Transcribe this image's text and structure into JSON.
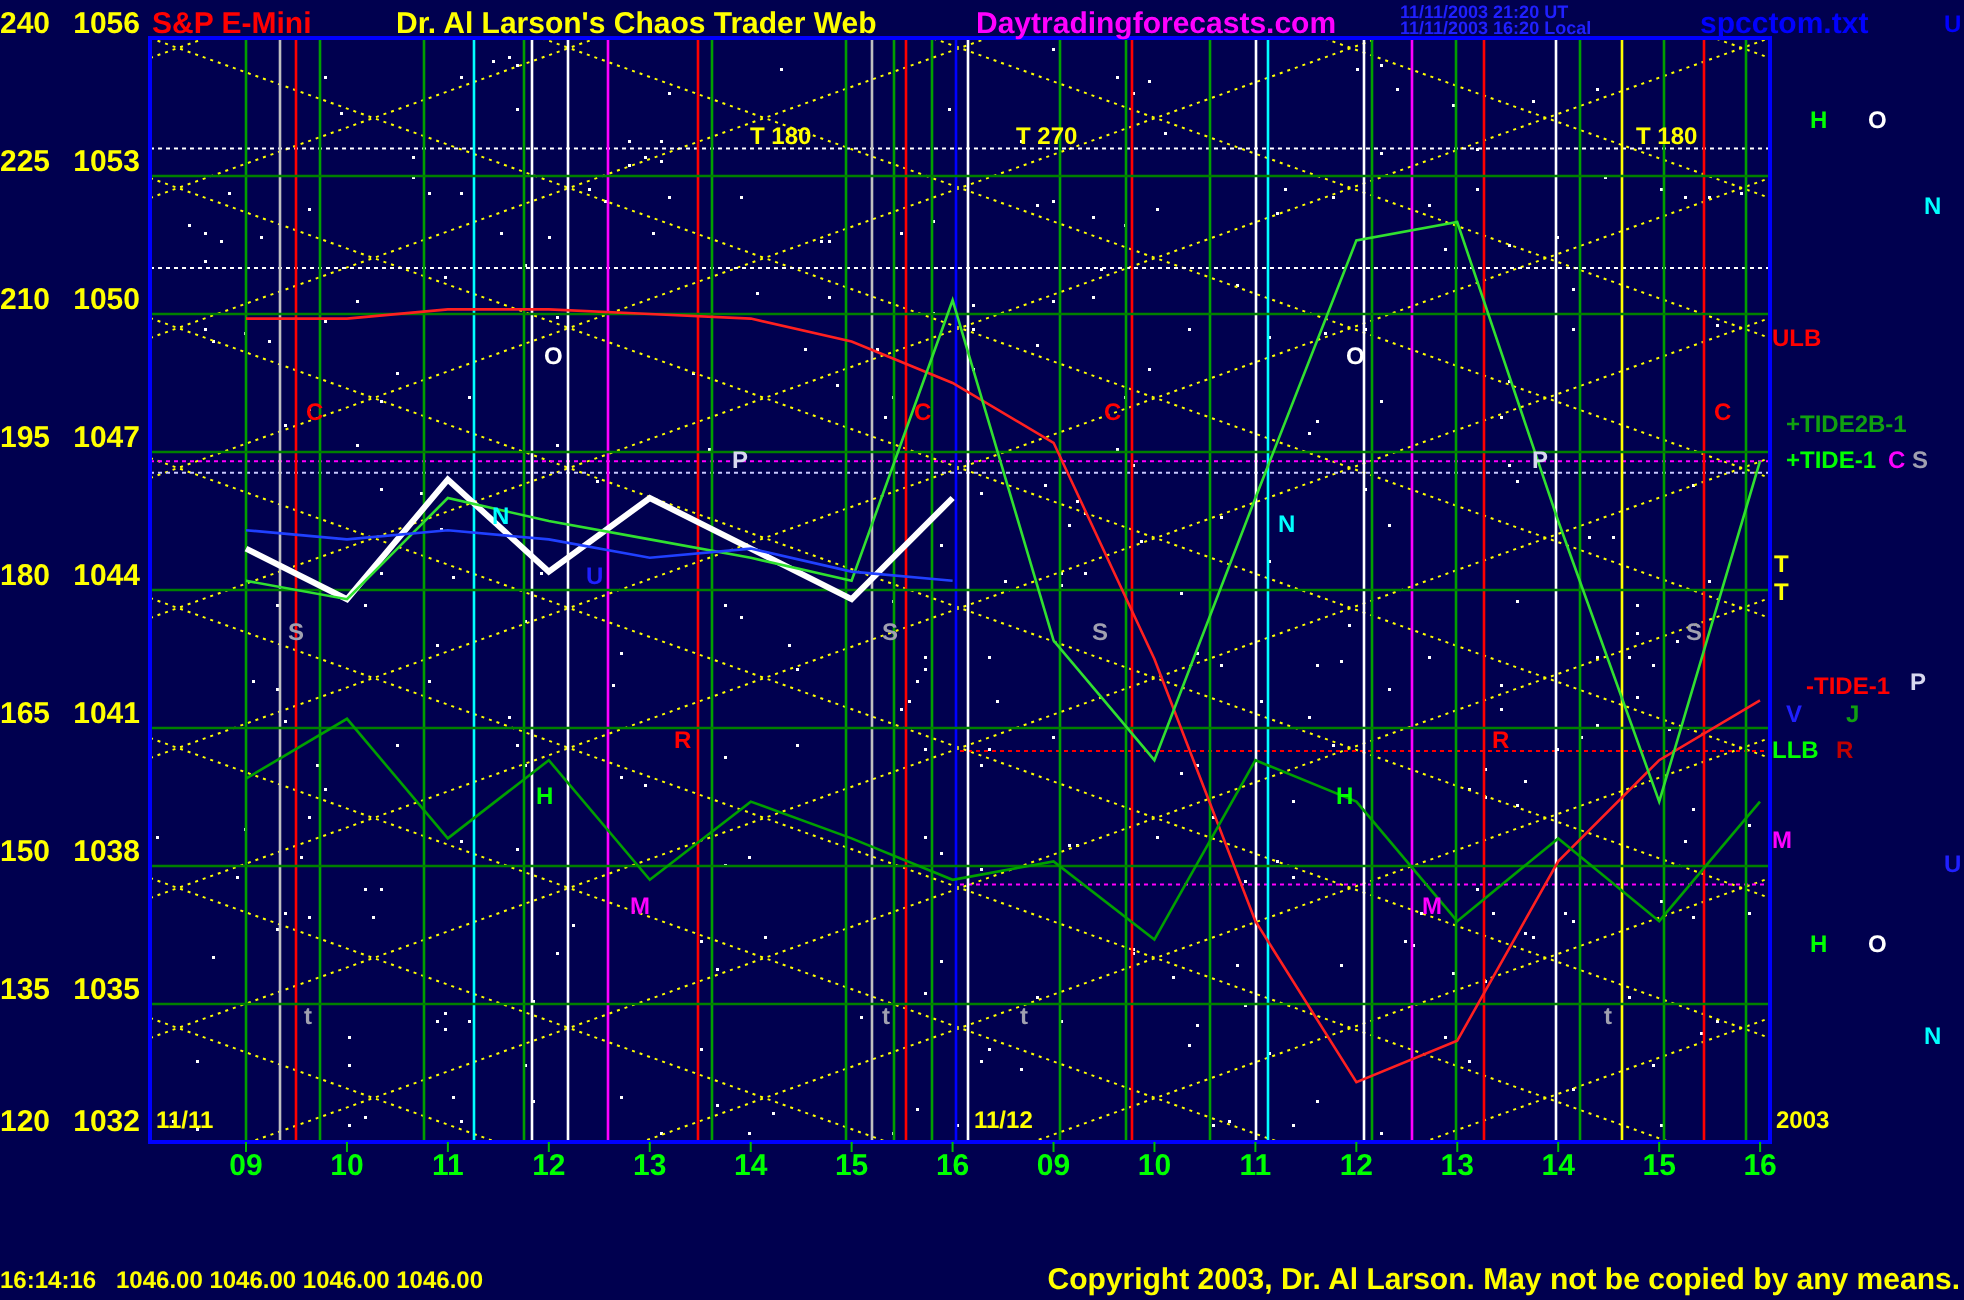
{
  "header": [
    {
      "kind": "site",
      "text": "Dr. Al Larson's Chaos Trader Web"
    },
    {
      "kind": "link",
      "text": "Daytradingforecasts.com"
    },
    {
      "kind": "timestamp",
      "text": "11/11/2003 21:20 UT"
    },
    {
      "kind": "timestamp",
      "text": "11/11/2003 16:20 Local"
    },
    {
      "kind": "file",
      "text": "spcctom.txt"
    },
    {
      "kind": "marker",
      "text": "U"
    }
  ],
  "chart": {
    "scale_labels": [
      "240",
      "225",
      "210",
      "195",
      "180",
      "165",
      "150",
      "135",
      "120"
    ],
    "chart_data": {
      "type": "line",
      "title": "S&P E-Mini",
      "categories": [
        "09",
        "10",
        "11",
        "12",
        "13",
        "14",
        "15",
        "16",
        "09",
        "10",
        "11",
        "12",
        "13",
        "14",
        "15",
        "16"
      ],
      "series": [
        {
          "color": "#ffffff",
          "values": [
            1044.9,
            1043.8,
            1046.4,
            1044.4,
            1046.0,
            1044.9,
            1043.8,
            1046.0,
            null,
            null,
            null,
            null,
            null,
            null,
            null,
            null
          ]
        },
        {
          "color": "#ff2020",
          "values": [
            1049.9,
            1049.9,
            1050.1,
            1050.1,
            1050.0,
            1049.9,
            1049.4,
            1048.5,
            1047.2,
            1042.5,
            1036.8,
            1033.3,
            1034.2,
            1038.1,
            1040.3,
            1041.6
          ]
        },
        {
          "color": "#30e030",
          "values": [
            1044.2,
            1043.8,
            1046.0,
            1045.5,
            1045.1,
            1044.7,
            1044.2,
            1050.3,
            1042.9,
            1040.3,
            1046.0,
            1051.6,
            1052.0,
            1045.5,
            1039.4,
            1046.8
          ]
        },
        {
          "color": "#2040ff",
          "values": [
            1045.3,
            1045.1,
            1045.3,
            1045.1,
            1044.7,
            1044.9,
            1044.4,
            1044.2,
            null,
            null,
            null,
            null,
            null,
            null,
            null,
            null
          ]
        },
        {
          "color": "#00a000",
          "values": [
            1039.9,
            1041.2,
            1038.6,
            1040.3,
            1037.7,
            1039.4,
            1038.6,
            1037.7,
            1038.1,
            1036.4,
            1040.3,
            1039.4,
            1036.8,
            1038.6,
            1036.8,
            1039.4
          ]
        }
      ],
      "ylim": [
        1032,
        1056
      ],
      "yticks": [
        1056,
        1053,
        1050,
        1047,
        1044,
        1041,
        1038,
        1035,
        1032
      ],
      "grid": true
    },
    "markers": [
      {
        "text": "H",
        "color": "#00ff00"
      },
      {
        "text": "O",
        "color": "#ffffff"
      },
      {
        "text": "T 180",
        "color": "#ffff00"
      },
      {
        "text": "T 270",
        "color": "#ffff00"
      },
      {
        "text": "T 180",
        "color": "#ffff00"
      },
      {
        "text": "N",
        "color": "#00ffff"
      },
      {
        "text": "ULB",
        "color": "#ff0000"
      },
      {
        "text": "O",
        "color": "#ffffff"
      },
      {
        "text": "O",
        "color": "#ffffff"
      },
      {
        "text": "C",
        "color": "#ff0000"
      },
      {
        "text": "C",
        "color": "#ff0000"
      },
      {
        "text": "C",
        "color": "#ff0000"
      },
      {
        "text": "C",
        "color": "#ff0000"
      },
      {
        "text": "+TIDE2B-1",
        "color": "#10a010"
      },
      {
        "text": "P",
        "color": "#d8d8f0"
      },
      {
        "text": "P",
        "color": "#d8d8f0"
      },
      {
        "text": "+TIDE-1",
        "color": "#00ff00"
      },
      {
        "text": "C",
        "color": "#ff00ff"
      },
      {
        "text": "S",
        "color": "#a0a0b0"
      },
      {
        "text": "N",
        "color": "#00ffff"
      },
      {
        "text": "N",
        "color": "#00ffff"
      },
      {
        "text": "T",
        "color": "#ffff00"
      },
      {
        "text": "U",
        "color": "#2020ff"
      },
      {
        "text": "T",
        "color": "#ffff00"
      },
      {
        "text": "S",
        "color": "#a0a0b0"
      },
      {
        "text": "S",
        "color": "#a0a0b0"
      },
      {
        "text": "S",
        "color": "#a0a0b0"
      },
      {
        "text": "S",
        "color": "#a0a0b0"
      },
      {
        "text": "P",
        "color": "#d8d8f0"
      },
      {
        "text": "-TIDE-1",
        "color": "#ff0000"
      },
      {
        "text": "V",
        "color": "#2020ff"
      },
      {
        "text": "J",
        "color": "#10a010"
      },
      {
        "text": "R",
        "color": "#ff0000"
      },
      {
        "text": "R",
        "color": "#ff0000"
      },
      {
        "text": "LLB",
        "color": "#00ff00"
      },
      {
        "text": "R",
        "color": "#c00000"
      },
      {
        "text": "H",
        "color": "#00ff00"
      },
      {
        "text": "H",
        "color": "#00ff00"
      },
      {
        "text": "M",
        "color": "#ff00ff"
      },
      {
        "text": "U",
        "color": "#2020ff"
      },
      {
        "text": "M",
        "color": "#ff00ff"
      },
      {
        "text": "M",
        "color": "#ff00ff"
      },
      {
        "text": "H",
        "color": "#00ff00"
      },
      {
        "text": "O",
        "color": "#ffffff"
      },
      {
        "text": "t",
        "color": "#a0a0b0"
      },
      {
        "text": "t",
        "color": "#a0a0b0"
      },
      {
        "text": "t",
        "color": "#a0a0b0"
      },
      {
        "text": "t",
        "color": "#a0a0b0"
      },
      {
        "text": "N",
        "color": "#00ffff"
      },
      {
        "text": "11/11",
        "color": "#ffff00"
      },
      {
        "text": "11/12",
        "color": "#ffff00"
      },
      {
        "text": "2003",
        "color": "#ffff00"
      }
    ]
  },
  "footer": {
    "time": "16:14:16",
    "quotes": [
      "1046.00",
      "1046.00",
      "1046.00",
      "1046.00"
    ],
    "copyright": "Copyright 2003, Dr. Al Larson. May not be copied by any means."
  }
}
